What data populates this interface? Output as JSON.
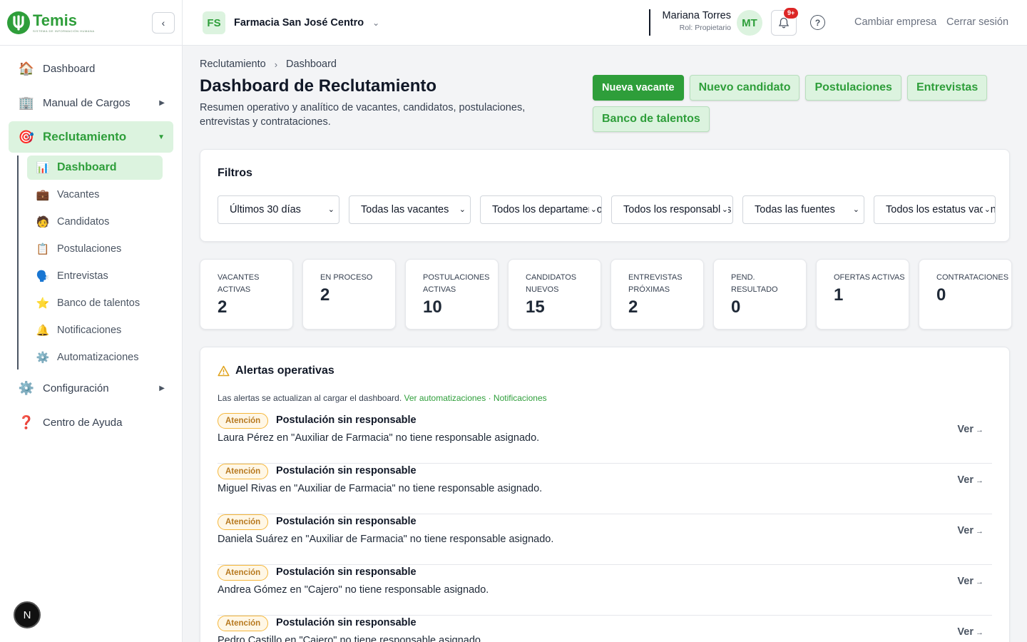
{
  "brand": {
    "name": "Temis",
    "tagline": "SISTEMA DE INFORMACIÓN HUMANA",
    "color": "#2e9e3a"
  },
  "sidebar": {
    "items": [
      {
        "label": "Dashboard",
        "icon": "house-icon"
      },
      {
        "label": "Manual de Cargos",
        "icon": "building-icon"
      },
      {
        "label": "Reclutamiento",
        "icon": "target-icon"
      },
      {
        "label": "Configuración",
        "icon": "gear-icon"
      },
      {
        "label": "Centro de Ayuda",
        "icon": "question-icon"
      }
    ],
    "subitems": [
      {
        "label": "Dashboard",
        "icon": "chart-icon"
      },
      {
        "label": "Vacantes",
        "icon": "briefcase-icon"
      },
      {
        "label": "Candidatos",
        "icon": "person-icon"
      },
      {
        "label": "Postulaciones",
        "icon": "clipboard-icon"
      },
      {
        "label": "Entrevistas",
        "icon": "speaking-head-icon"
      },
      {
        "label": "Banco de talentos",
        "icon": "star-icon"
      },
      {
        "label": "Notificaciones",
        "icon": "bell-icon"
      },
      {
        "label": "Automatizaciones",
        "icon": "gear-icon"
      }
    ],
    "badge": "N"
  },
  "topbar": {
    "company_initials": "FS",
    "company_name": "Farmacia San José Centro",
    "user_name": "Mariana Torres",
    "user_role": "Rol: Propietario",
    "user_initials": "MT",
    "notifications_count": "9+",
    "switch_company": "Cambiar empresa",
    "logout": "Cerrar sesión"
  },
  "breadcrumb": {
    "parent": "Reclutamiento",
    "current": "Dashboard"
  },
  "page": {
    "title": "Dashboard de Reclutamiento",
    "subtitle": "Resumen operativo y analítico de vacantes, candidatos, postulaciones, entrevistas y contrataciones."
  },
  "actions": {
    "new_vacancy": "Nueva vacante",
    "new_candidate": "Nuevo candidato",
    "applications": "Postulaciones",
    "interviews": "Entrevistas",
    "talent_bank": "Banco de talentos"
  },
  "filters": {
    "title": "Filtros",
    "selects": [
      "Últimos 30 días",
      "Todas las vacantes",
      "Todos los departamentos",
      "Todos los responsables",
      "Todas las fuentes",
      "Todos los estatus vacantes"
    ]
  },
  "stats": [
    {
      "label": "Vacantes activas",
      "value": "2"
    },
    {
      "label": "En proceso",
      "value": "2"
    },
    {
      "label": "Postulaciones activas",
      "value": "10"
    },
    {
      "label": "Candidatos nuevos",
      "value": "15"
    },
    {
      "label": "Entrevistas próximas",
      "value": "2"
    },
    {
      "label": "Pend. resultado",
      "value": "0"
    },
    {
      "label": "Ofertas activas",
      "value": "1"
    },
    {
      "label": "Contrataciones",
      "value": "0"
    }
  ],
  "alerts": {
    "title": "Alertas operativas",
    "note": "Las alertas se actualizan al cargar el dashboard.",
    "link_automations": "Ver automatizaciones",
    "link_separator": "·",
    "link_notifications": "Notificaciones",
    "view_label": "Ver",
    "rows": [
      {
        "badge": "Atención",
        "title": "Postulación sin responsable",
        "desc": "Laura Pérez en \"Auxiliar de Farmacia\" no tiene responsable asignado."
      },
      {
        "badge": "Atención",
        "title": "Postulación sin responsable",
        "desc": "Miguel Rivas en \"Auxiliar de Farmacia\" no tiene responsable asignado."
      },
      {
        "badge": "Atención",
        "title": "Postulación sin responsable",
        "desc": "Daniela Suárez en \"Auxiliar de Farmacia\" no tiene responsable asignado."
      },
      {
        "badge": "Atención",
        "title": "Postulación sin responsable",
        "desc": "Andrea Gómez en \"Cajero\" no tiene responsable asignado."
      },
      {
        "badge": "Atención",
        "title": "Postulación sin responsable",
        "desc": "Pedro Castillo en \"Cajero\" no tiene responsable asignado."
      }
    ]
  },
  "colors": {
    "accent": "#2e9e3a",
    "accent_light": "#dcf3df",
    "warning": "#f5b73b",
    "danger": "#dc2626"
  }
}
